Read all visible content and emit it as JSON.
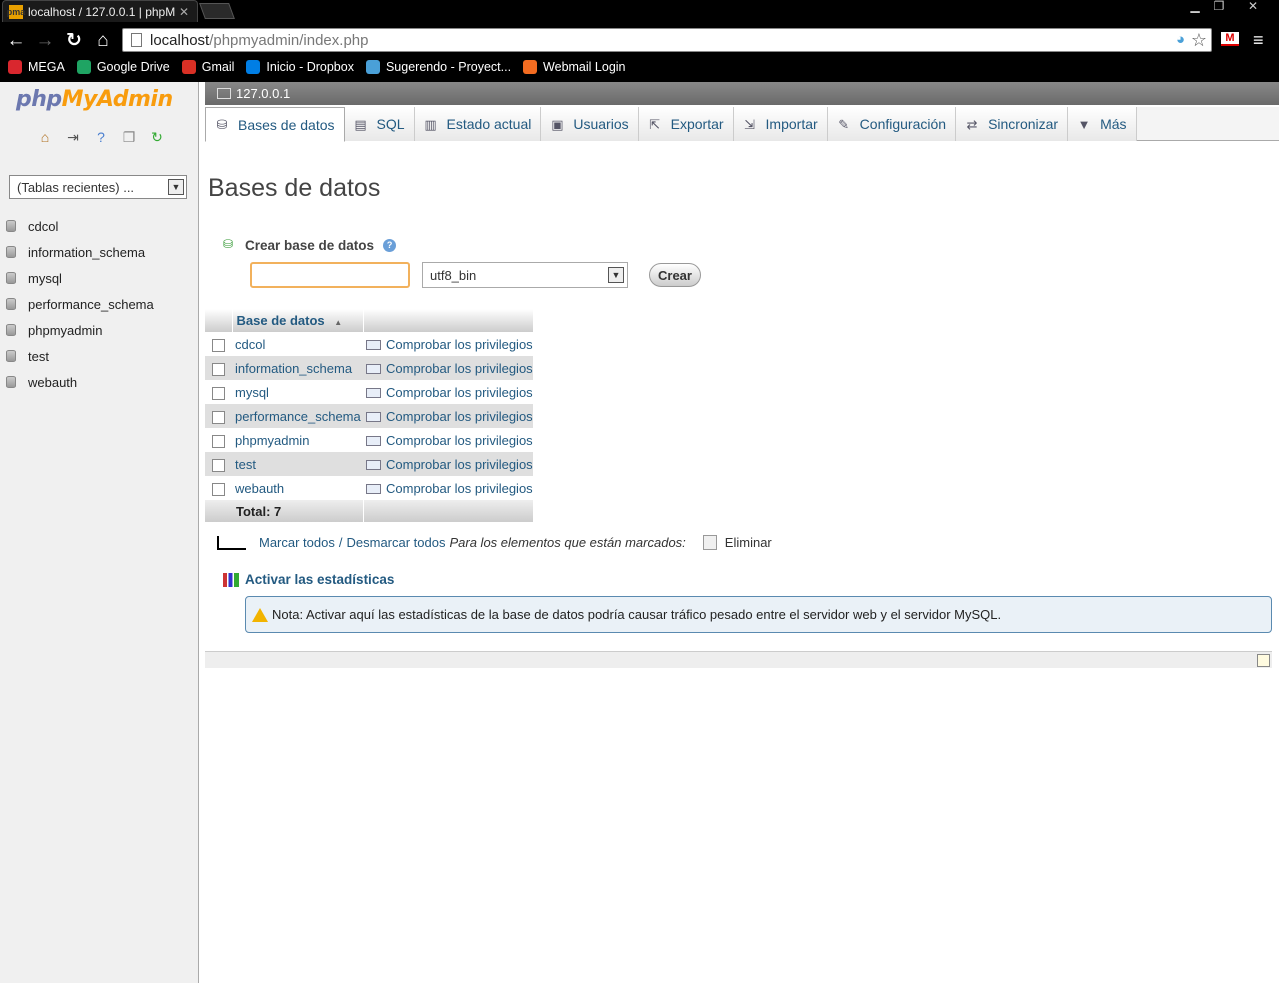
{
  "browser": {
    "tab_title": "localhost / 127.0.0.1 | phpM",
    "url_host": "localhost",
    "url_path": "/phpmyadmin/index.php",
    "bookmarks": [
      {
        "label": "MEGA",
        "icon": "mega-icon",
        "color": "#d9272e"
      },
      {
        "label": "Google Drive",
        "icon": "google-drive-icon",
        "color": "#1fa463"
      },
      {
        "label": "Gmail",
        "icon": "gmail-icon",
        "color": "#d93025"
      },
      {
        "label": "Inicio - Dropbox",
        "icon": "dropbox-icon",
        "color": "#007ee5"
      },
      {
        "label": "Sugerendo - Proyect...",
        "icon": "link-icon",
        "color": "#4aa0d8"
      },
      {
        "label": "Webmail Login",
        "icon": "cpanel-icon",
        "color": "#f36c21"
      }
    ]
  },
  "sidebar": {
    "logo": {
      "php": "php",
      "my": "My",
      "admin": "Admin"
    },
    "recent_tables": "(Tablas recientes) ...",
    "databases": [
      "cdcol",
      "information_schema",
      "mysql",
      "performance_schema",
      "phpmyadmin",
      "test",
      "webauth"
    ]
  },
  "server": {
    "label": "127.0.0.1"
  },
  "tabs": [
    {
      "label": "Bases de datos",
      "icon": "database-icon",
      "active": true
    },
    {
      "label": "SQL",
      "icon": "sql-icon"
    },
    {
      "label": "Estado actual",
      "icon": "status-icon"
    },
    {
      "label": "Usuarios",
      "icon": "users-icon"
    },
    {
      "label": "Exportar",
      "icon": "export-icon"
    },
    {
      "label": "Importar",
      "icon": "import-icon"
    },
    {
      "label": "Configuración",
      "icon": "wrench-icon"
    },
    {
      "label": "Sincronizar",
      "icon": "sync-icon"
    },
    {
      "label": "Más",
      "icon": "chevron-down-icon"
    }
  ],
  "main": {
    "title": "Bases de datos",
    "create": {
      "heading": "Crear base de datos",
      "input_value": "",
      "collation": "utf8_bin",
      "button": "Crear"
    },
    "table": {
      "header": "Base de datos",
      "rows": [
        {
          "name": "cdcol",
          "priv": "Comprobar los privilegios"
        },
        {
          "name": "information_schema",
          "priv": "Comprobar los privilegios"
        },
        {
          "name": "mysql",
          "priv": "Comprobar los privilegios"
        },
        {
          "name": "performance_schema",
          "priv": "Comprobar los privilegios"
        },
        {
          "name": "phpmyadmin",
          "priv": "Comprobar los privilegios"
        },
        {
          "name": "test",
          "priv": "Comprobar los privilegios"
        },
        {
          "name": "webauth",
          "priv": "Comprobar los privilegios"
        }
      ],
      "total": "Total: 7"
    },
    "actions": {
      "check_all": "Marcar todos",
      "separator": "/",
      "uncheck_all": "Desmarcar todos",
      "marked_text": "Para los elementos que están marcados:",
      "delete": "Eliminar"
    },
    "stats": {
      "link": "Activar las estadísticas",
      "notice": "Nota: Activar aquí las estadísticas de la base de datos podría causar tráfico pesado entre el servidor web y el servidor MySQL."
    }
  }
}
